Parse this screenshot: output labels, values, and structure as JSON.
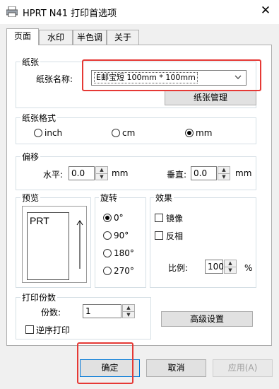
{
  "window": {
    "title": "HPRT N41 打印首选项",
    "close_icon": "✕"
  },
  "tabs": [
    "页面",
    "水印",
    "半色调",
    "关于"
  ],
  "paper": {
    "group_label": "纸张",
    "name_label": "纸张名称:",
    "selected": "E邮宝短 100mm * 100mm",
    "manage_button": "纸张管理"
  },
  "format": {
    "group_label": "纸张格式",
    "options": [
      "inch",
      "cm",
      "mm"
    ],
    "selected": "mm"
  },
  "offset": {
    "group_label": "偏移",
    "h_label": "水平:",
    "h_value": "0.0",
    "h_unit": "mm",
    "v_label": "垂直:",
    "v_value": "0.0",
    "v_unit": "mm"
  },
  "preview": {
    "group_label": "预览",
    "sample_text": "PRT"
  },
  "rotation": {
    "group_label": "旋转",
    "options": [
      "0°",
      "90°",
      "180°",
      "270°"
    ],
    "selected": "0°"
  },
  "effects": {
    "group_label": "效果",
    "mirror_label": "镜像",
    "mirror_checked": false,
    "invert_label": "反相",
    "invert_checked": false,
    "scale_label": "比例:",
    "scale_value": "100",
    "scale_unit": "%"
  },
  "copies": {
    "group_label": "打印份数",
    "count_label": "份数:",
    "count_value": "1",
    "reverse_label": "逆序打印",
    "reverse_checked": false
  },
  "advanced_button": "高级设置",
  "footer": {
    "ok": "确定",
    "cancel": "取消",
    "apply": "应用(A)"
  },
  "colors": {
    "highlight": "#e53935",
    "dialog_bg": "#f0f0f0",
    "selection_blue": "#0078d7"
  }
}
